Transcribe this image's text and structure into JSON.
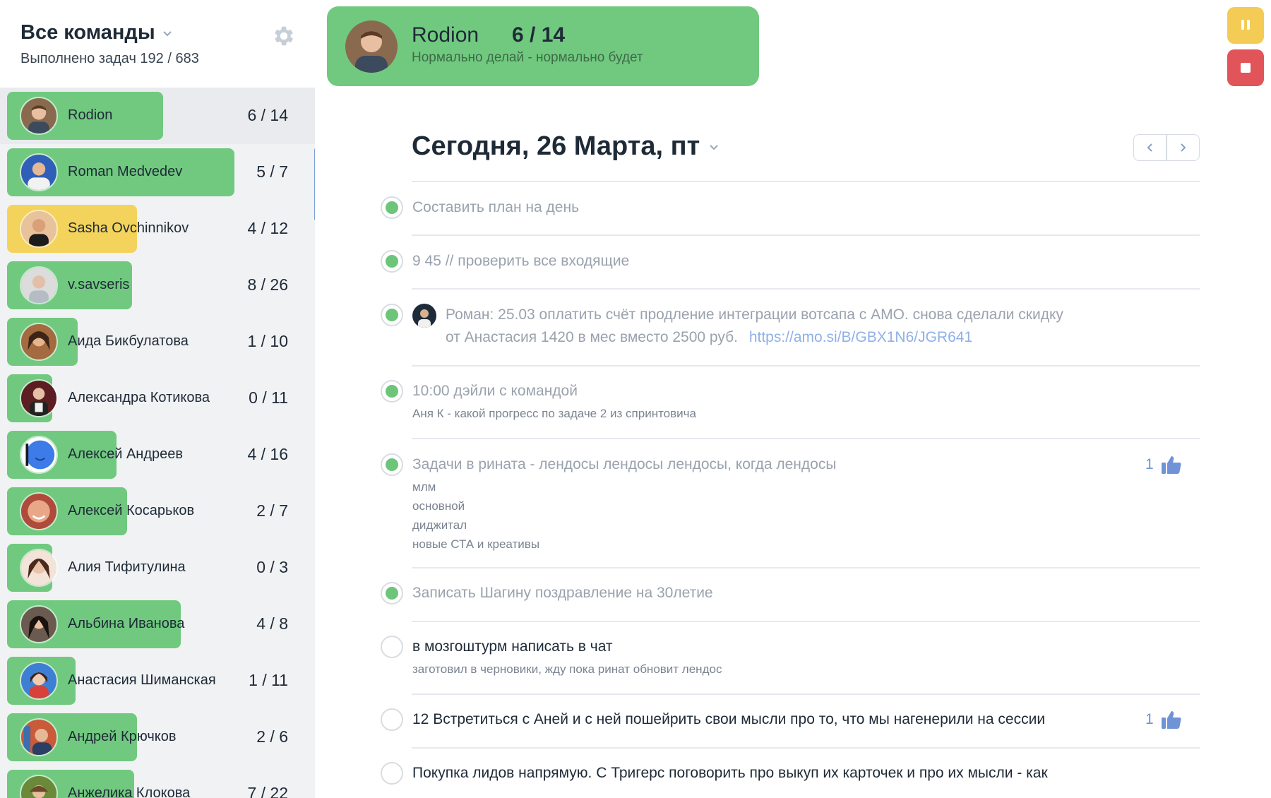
{
  "sidebar": {
    "title": "Все команды",
    "subtitle": "Выполнено задач 192 / 683",
    "members": [
      {
        "name": "Rodion",
        "count": "6 / 14",
        "progress": 0.43,
        "color": "#70c97f",
        "active": true
      },
      {
        "name": "Roman Medvedev",
        "count": "5 / 7",
        "progress": 0.71,
        "color": "#70c97f"
      },
      {
        "name": "Sasha Ovchinnikov",
        "count": "4 / 12",
        "progress": 0.33,
        "color": "#f3d35c"
      },
      {
        "name": "v.savseris",
        "count": "8 / 26",
        "progress": 0.31,
        "color": "#70c97f"
      },
      {
        "name": "Аида Бикбулатова",
        "count": "1 / 10",
        "progress": 0.1,
        "color": "#70c97f"
      },
      {
        "name": "Александра Котикова",
        "count": "0 / 11",
        "progress": 0.0,
        "color": "#70c97f"
      },
      {
        "name": "Алексей Андреев",
        "count": "4 / 16",
        "progress": 0.25,
        "color": "#70c97f"
      },
      {
        "name": "Алексей Косарьков",
        "count": "2 / 7",
        "progress": 0.29,
        "color": "#70c97f"
      },
      {
        "name": "Алия Тифитулина",
        "count": "0 / 3",
        "progress": 0.0,
        "color": "#70c97f"
      },
      {
        "name": "Альбина Иванова",
        "count": "4 / 8",
        "progress": 0.5,
        "color": "#70c97f"
      },
      {
        "name": "Анастасия Шиманская",
        "count": "1 / 11",
        "progress": 0.09,
        "color": "#70c97f"
      },
      {
        "name": "Андрей Крючков",
        "count": "2 / 6",
        "progress": 0.33,
        "color": "#70c97f"
      },
      {
        "name": "Анжелика Клокова",
        "count": "7 / 22",
        "progress": 0.32,
        "color": "#70c97f"
      }
    ]
  },
  "header": {
    "name": "Rodion",
    "count": "6 / 14",
    "motto": "Нормально делай - нормально будет"
  },
  "date": {
    "label": "Сегодня, 26 Марта, пт"
  },
  "tasks": [
    {
      "title": "Составить план на день",
      "done": true
    },
    {
      "title": "9 45 // проверить все входящие",
      "done": true
    },
    {
      "title": "Роман: 25.03 оплатить счёт продление интеграции вотсапа с АМО.  снова сделали скидку",
      "line2": "от Анастасия    1420 в мес вместо 2500 руб.",
      "link": "https://amo.si/B/GBX1N6/JGR641",
      "done": true,
      "author_avatar": true
    },
    {
      "title": "10:00 дэйли с командой",
      "notes": [
        "Аня К - какой прогресс по задаче 2 из спринтовича"
      ],
      "done": true
    },
    {
      "title": "Задачи в рината - лендосы лендосы лендосы, когда лендосы",
      "notes": [
        "млм",
        "основной",
        "диджитал",
        "новые СТА и креативы"
      ],
      "done": true,
      "likes": "1"
    },
    {
      "title": "Записать Шагину поздравление на 30летие",
      "done": true
    },
    {
      "title": "в мозгоштурм написать в чат",
      "notes": [
        "заготовил в черновики, жду пока ринат обновит лендос"
      ],
      "done": false
    },
    {
      "title": "12 Встретиться с Аней и с ней пошейрить свои мысли про то, что мы нагенерили на сессии",
      "done": false,
      "likes": "1"
    },
    {
      "title": "Покупка лидов напрямую. С Тригерс поговорить про выкуп их карточек и про их мысли - как",
      "done": false
    }
  ]
}
